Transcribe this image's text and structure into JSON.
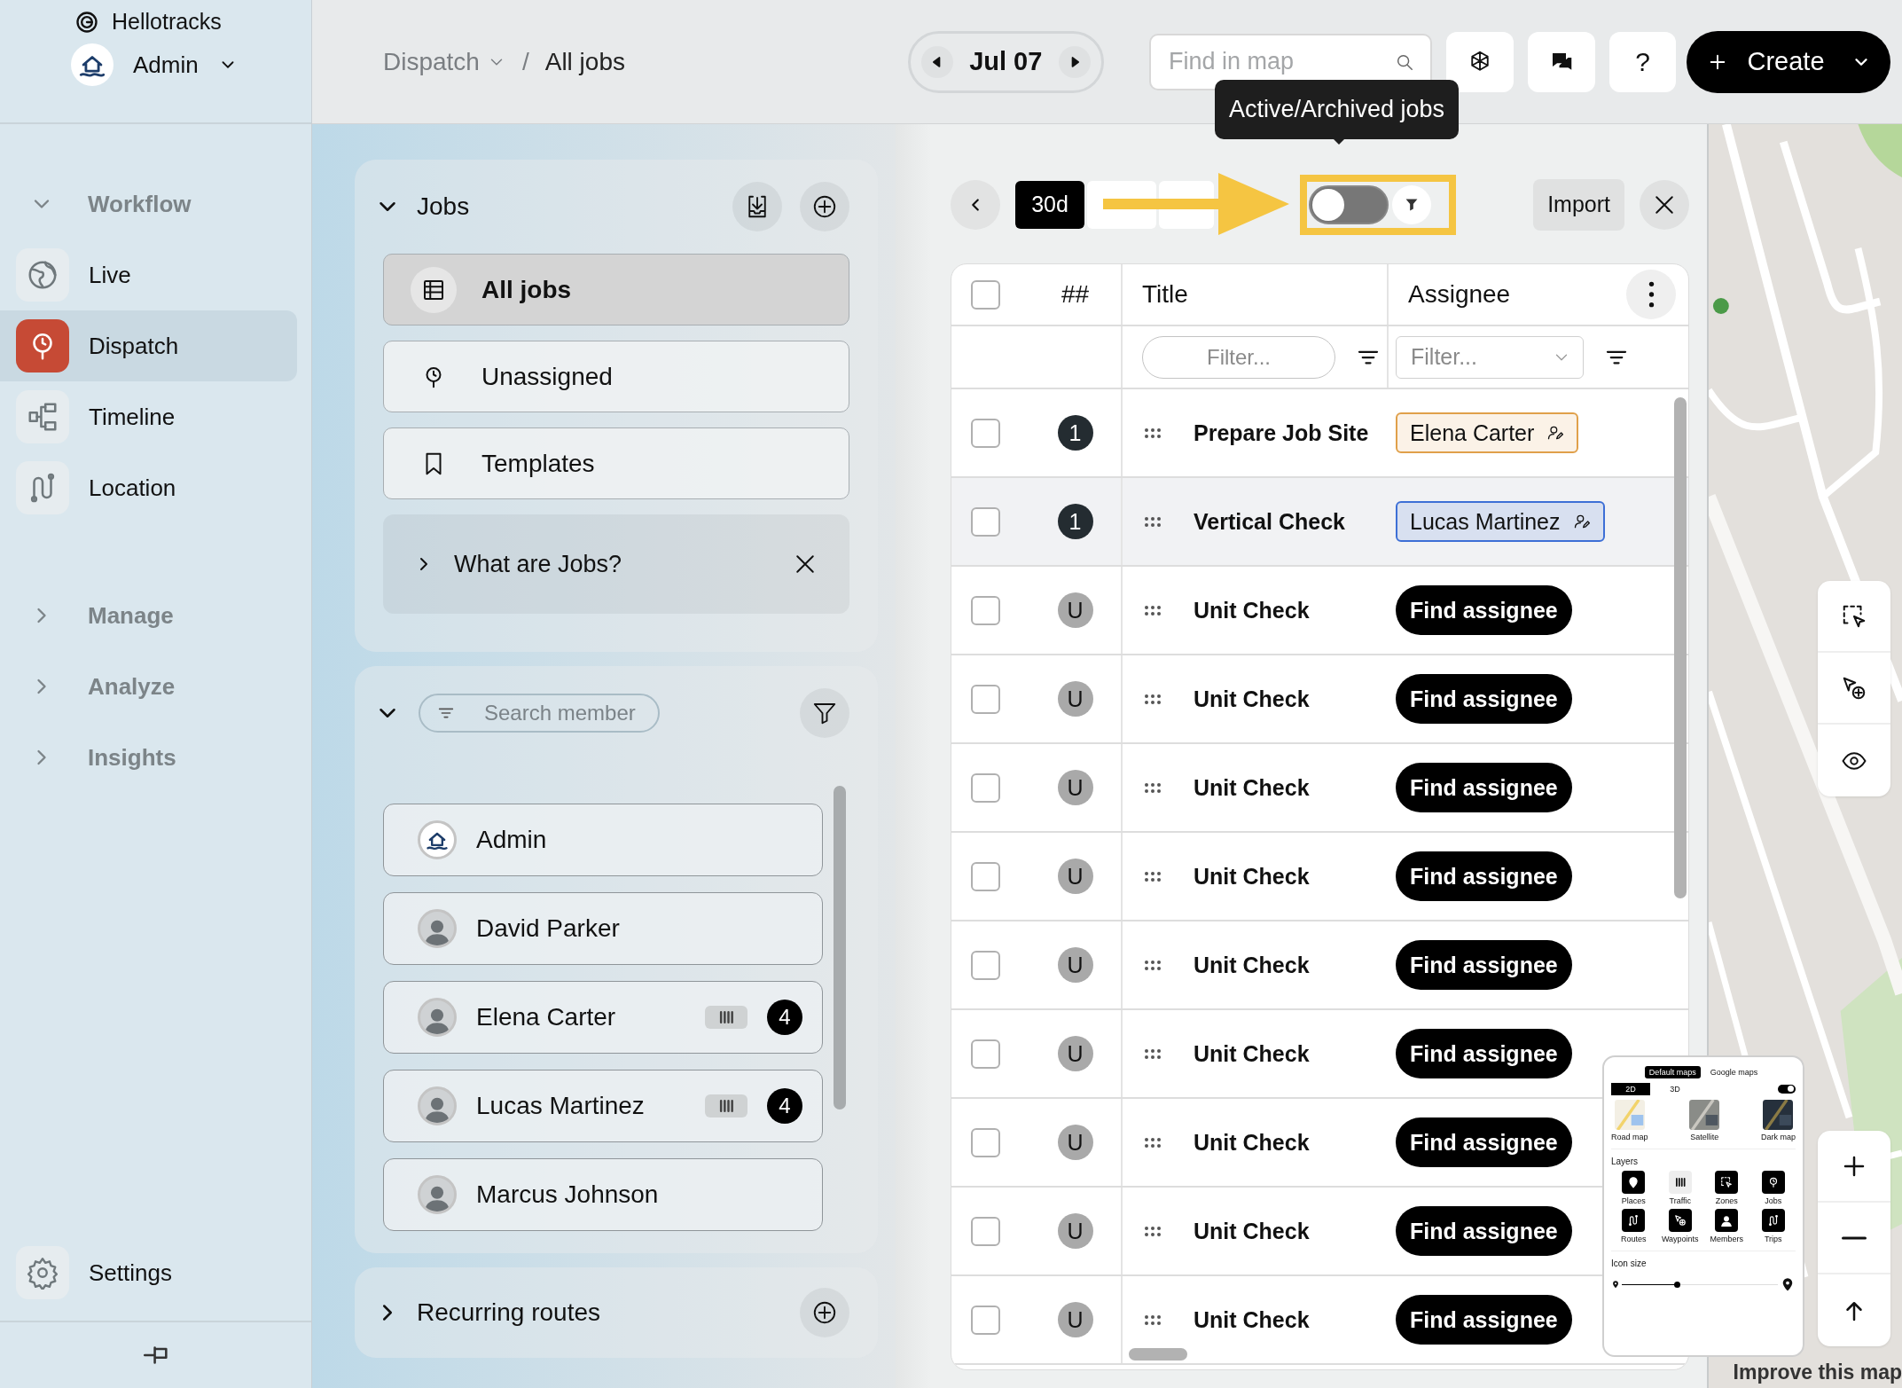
{
  "app": {
    "name": "Hellotracks",
    "account": "Admin"
  },
  "nav": [
    {
      "label": "Workflow",
      "expanded": true,
      "children": [
        {
          "label": "Live",
          "kind": "globe",
          "selected": false
        },
        {
          "label": "Dispatch",
          "kind": "dispatch",
          "selected": true
        },
        {
          "label": "Timeline",
          "kind": "timeline",
          "selected": false
        },
        {
          "label": "Location",
          "kind": "route",
          "selected": false
        }
      ]
    },
    {
      "label": "Manage",
      "expanded": false
    },
    {
      "label": "Analyze",
      "expanded": false
    },
    {
      "label": "Insights",
      "expanded": false
    }
  ],
  "settings": {
    "label": "Settings"
  },
  "breadcrumb": {
    "separator": "/",
    "items": [
      {
        "label": "Dispatch",
        "dropdown": true
      },
      {
        "label": "All jobs",
        "dropdown": false
      }
    ]
  },
  "date": {
    "label": "Jul 07"
  },
  "map_search": {
    "placeholder": "Find in map"
  },
  "help": {
    "label": "?"
  },
  "create": {
    "label": "Create"
  },
  "jobs_panel": {
    "title": "Jobs",
    "expanded": true,
    "views": [
      {
        "label": "All jobs",
        "kind": "table",
        "selected": true
      },
      {
        "label": "Unassigned",
        "kind": "dispatch",
        "selected": false
      },
      {
        "label": "Templates",
        "kind": "bookmark",
        "selected": false
      }
    ],
    "info": {
      "label": "What are Jobs?",
      "expanded": false
    }
  },
  "members_panel": {
    "expanded": true,
    "search": {
      "placeholder": "Search member"
    },
    "members": [
      {
        "name": "Admin",
        "kind": "logo"
      },
      {
        "name": "David Parker",
        "kind": "person"
      },
      {
        "name": "Elena Carter",
        "kind": "person",
        "job_count": "4"
      },
      {
        "name": "Lucas Martinez",
        "kind": "person",
        "job_count": "4"
      },
      {
        "name": "Marcus Johnson",
        "kind": "person"
      }
    ]
  },
  "recurring_routes": {
    "title": "Recurring routes",
    "expanded": false
  },
  "toolbar": {
    "range_buttons": [
      {
        "label": "30d",
        "selected": true
      },
      {
        "selected": false
      },
      {
        "selected": false
      }
    ],
    "archived_toggle": {
      "on": false,
      "tooltip": "Active/Archived jobs"
    },
    "callout": {
      "kind": "arrow-and-frame"
    },
    "import": "Import"
  },
  "table": {
    "all_checked": false,
    "columns": [
      {
        "label": "##"
      },
      {
        "label": "Title",
        "filter": {
          "placeholder": "Filter..."
        }
      },
      {
        "label": "Assignee",
        "filter": {
          "placeholder": "Filter..."
        }
      }
    ],
    "rows": [
      {
        "checked": false,
        "highlighted": false,
        "badge": {
          "kind": "number",
          "text": "1"
        },
        "title": "Prepare Job Site",
        "assignee": {
          "kind": "chip",
          "name": "Elena Carter",
          "color": "#e0a04a"
        }
      },
      {
        "checked": false,
        "highlighted": true,
        "badge": {
          "kind": "number",
          "text": "1"
        },
        "title": "Vertical Check",
        "assignee": {
          "kind": "chip",
          "name": "Lucas Martinez",
          "color": "#3d6fd6"
        }
      },
      {
        "checked": false,
        "highlighted": false,
        "badge": {
          "kind": "unassigned",
          "text": "U"
        },
        "title": "Unit Check",
        "assignee": {
          "kind": "button",
          "label": "Find assignee"
        }
      },
      {
        "checked": false,
        "highlighted": false,
        "badge": {
          "kind": "unassigned",
          "text": "U"
        },
        "title": "Unit Check",
        "assignee": {
          "kind": "button",
          "label": "Find assignee"
        }
      },
      {
        "checked": false,
        "highlighted": false,
        "badge": {
          "kind": "unassigned",
          "text": "U"
        },
        "title": "Unit Check",
        "assignee": {
          "kind": "button",
          "label": "Find assignee"
        }
      },
      {
        "checked": false,
        "highlighted": false,
        "badge": {
          "kind": "unassigned",
          "text": "U"
        },
        "title": "Unit Check",
        "assignee": {
          "kind": "button",
          "label": "Find assignee"
        }
      },
      {
        "checked": false,
        "highlighted": false,
        "badge": {
          "kind": "unassigned",
          "text": "U"
        },
        "title": "Unit Check",
        "assignee": {
          "kind": "button",
          "label": "Find assignee"
        }
      },
      {
        "checked": false,
        "highlighted": false,
        "badge": {
          "kind": "unassigned",
          "text": "U"
        },
        "title": "Unit Check",
        "assignee": {
          "kind": "button",
          "label": "Find assignee"
        }
      },
      {
        "checked": false,
        "highlighted": false,
        "badge": {
          "kind": "unassigned",
          "text": "U"
        },
        "title": "Unit Check",
        "assignee": {
          "kind": "button",
          "label": "Find assignee"
        }
      },
      {
        "checked": false,
        "highlighted": false,
        "badge": {
          "kind": "unassigned",
          "text": "U"
        },
        "title": "Unit Check",
        "assignee": {
          "kind": "button",
          "label": "Find assignee"
        }
      },
      {
        "checked": false,
        "highlighted": false,
        "badge": {
          "kind": "unassigned",
          "text": "U"
        },
        "title": "Unit Check",
        "assignee": {
          "kind": "button",
          "label": "Find assignee"
        }
      }
    ]
  },
  "map": {
    "kind": "picture",
    "attribution": "Improve this map",
    "settings_preview": {
      "providers": [
        {
          "label": "Default maps",
          "selected": true
        },
        {
          "label": "Google maps",
          "selected": false
        }
      ],
      "modes": [
        {
          "label": "2D",
          "selected": true
        },
        {
          "label": "3D",
          "selected": false
        }
      ],
      "toggle_on": true,
      "styles": [
        {
          "label": "Road map",
          "kind": "road"
        },
        {
          "label": "Satellite",
          "kind": "satellite"
        },
        {
          "label": "Dark map",
          "kind": "dark"
        }
      ],
      "layers_title": "Layers",
      "layers": [
        {
          "label": "Places",
          "on": true
        },
        {
          "label": "Traffic",
          "on": false
        },
        {
          "label": "Zones",
          "on": true
        },
        {
          "label": "Jobs",
          "on": true
        },
        {
          "label": "Routes",
          "on": true
        },
        {
          "label": "Waypoints",
          "on": true
        },
        {
          "label": "Members",
          "on": true
        },
        {
          "label": "Trips",
          "on": true
        }
      ],
      "icon_size_title": "Icon size",
      "icon_size": {
        "level": 0.35
      }
    }
  }
}
